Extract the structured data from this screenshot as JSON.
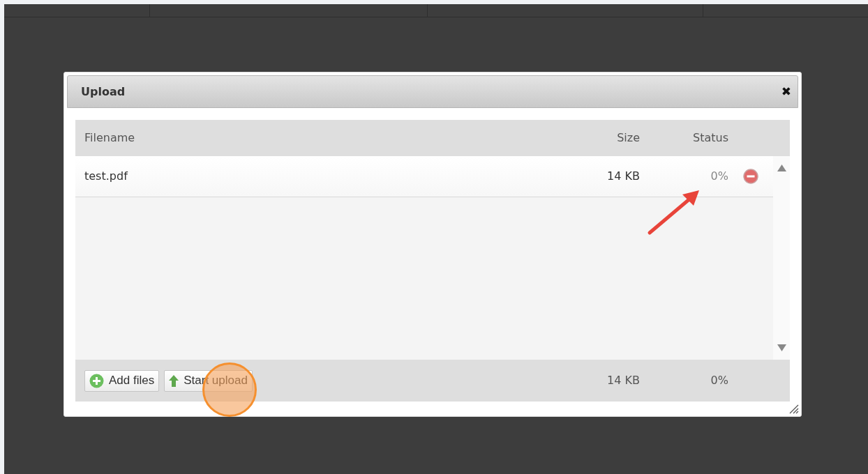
{
  "dialog": {
    "title": "Upload",
    "close_label": "✖"
  },
  "table": {
    "columns": [
      {
        "label": "Filename"
      },
      {
        "label": "Size"
      },
      {
        "label": "Status"
      }
    ],
    "rows": [
      {
        "filename": "test.pdf",
        "size": "14 KB",
        "status": "0%"
      }
    ]
  },
  "footer": {
    "buttons": [
      {
        "kind": "add",
        "label": "Add files"
      },
      {
        "kind": "start",
        "label": "Start upload"
      }
    ],
    "total_size": "14 KB",
    "total_status": "0%"
  }
}
